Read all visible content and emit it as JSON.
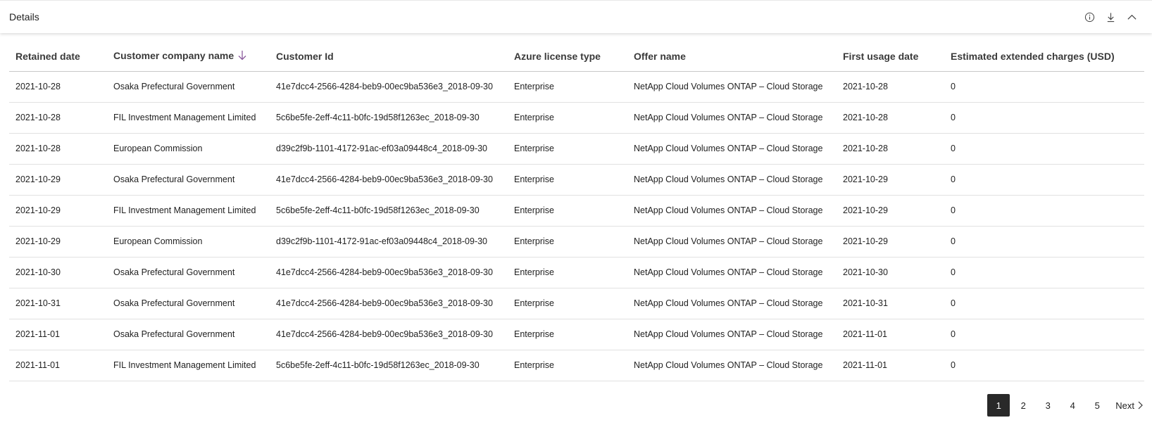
{
  "panel": {
    "title": "Details"
  },
  "header_icons": [
    "info-icon",
    "download-icon",
    "chevron-up-icon"
  ],
  "table": {
    "columns": [
      "Retained date",
      "Customer company name",
      "Customer Id",
      "Azure license type",
      "Offer name",
      "First usage date",
      "Estimated extended charges (USD)"
    ],
    "sorted_column": "Customer company name",
    "sort_direction": "descending",
    "rows": [
      [
        "2021-10-28",
        "Osaka Prefectural Government",
        "41e7dcc4-2566-4284-beb9-00ec9ba536e3_2018-09-30",
        "Enterprise",
        "NetApp Cloud Volumes ONTAP – Cloud Storage",
        "2021-10-28",
        "0"
      ],
      [
        "2021-10-28",
        "FIL Investment Management Limited",
        "5c6be5fe-2eff-4c11-b0fc-19d58f1263ec_2018-09-30",
        "Enterprise",
        "NetApp Cloud Volumes ONTAP – Cloud Storage",
        "2021-10-28",
        "0"
      ],
      [
        "2021-10-28",
        "European Commission",
        "d39c2f9b-1101-4172-91ac-ef03a09448c4_2018-09-30",
        "Enterprise",
        "NetApp Cloud Volumes ONTAP – Cloud Storage",
        "2021-10-28",
        "0"
      ],
      [
        "2021-10-29",
        "Osaka Prefectural Government",
        "41e7dcc4-2566-4284-beb9-00ec9ba536e3_2018-09-30",
        "Enterprise",
        "NetApp Cloud Volumes ONTAP – Cloud Storage",
        "2021-10-29",
        "0"
      ],
      [
        "2021-10-29",
        "FIL Investment Management Limited",
        "5c6be5fe-2eff-4c11-b0fc-19d58f1263ec_2018-09-30",
        "Enterprise",
        "NetApp Cloud Volumes ONTAP – Cloud Storage",
        "2021-10-29",
        "0"
      ],
      [
        "2021-10-29",
        "European Commission",
        "d39c2f9b-1101-4172-91ac-ef03a09448c4_2018-09-30",
        "Enterprise",
        "NetApp Cloud Volumes ONTAP – Cloud Storage",
        "2021-10-29",
        "0"
      ],
      [
        "2021-10-30",
        "Osaka Prefectural Government",
        "41e7dcc4-2566-4284-beb9-00ec9ba536e3_2018-09-30",
        "Enterprise",
        "NetApp Cloud Volumes ONTAP – Cloud Storage",
        "2021-10-30",
        "0"
      ],
      [
        "2021-10-31",
        "Osaka Prefectural Government",
        "41e7dcc4-2566-4284-beb9-00ec9ba536e3_2018-09-30",
        "Enterprise",
        "NetApp Cloud Volumes ONTAP – Cloud Storage",
        "2021-10-31",
        "0"
      ],
      [
        "2021-11-01",
        "Osaka Prefectural Government",
        "41e7dcc4-2566-4284-beb9-00ec9ba536e3_2018-09-30",
        "Enterprise",
        "NetApp Cloud Volumes ONTAP – Cloud Storage",
        "2021-11-01",
        "0"
      ],
      [
        "2021-11-01",
        "FIL Investment Management Limited",
        "5c6be5fe-2eff-4c11-b0fc-19d58f1263ec_2018-09-30",
        "Enterprise",
        "NetApp Cloud Volumes ONTAP – Cloud Storage",
        "2021-11-01",
        "0"
      ]
    ]
  },
  "pagination": {
    "pages": [
      "1",
      "2",
      "3",
      "4",
      "5"
    ],
    "current": "1",
    "next_label": "Next"
  },
  "colors": {
    "active_page_bg": "#292929",
    "sort_arrow": "#8a5a9c"
  }
}
